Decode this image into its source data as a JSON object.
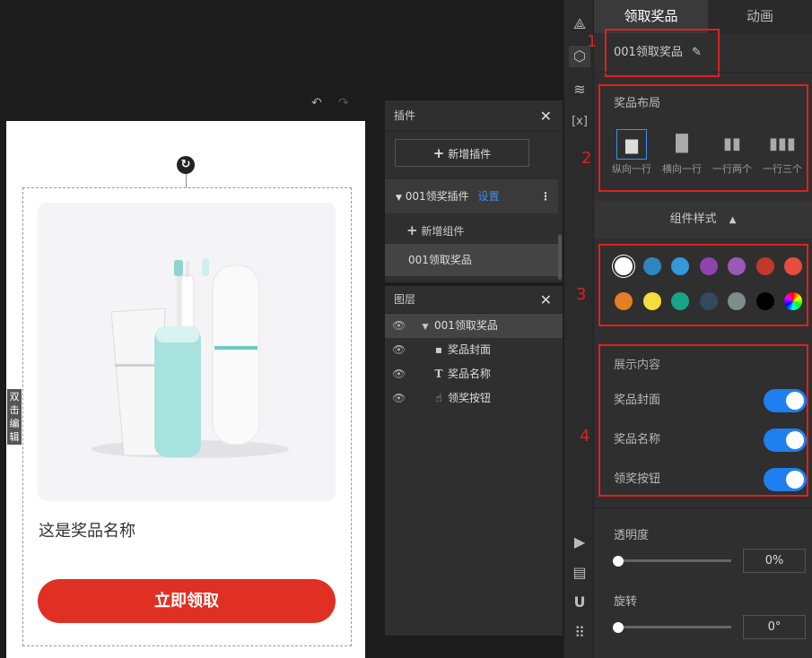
{
  "canvas": {
    "undo_icon": "undo-icon",
    "redo_icon": "redo-icon",
    "prize_name": "这是奖品名称",
    "claim_button": "立即领取",
    "double_click_edit": "双击编辑"
  },
  "plugin_panel": {
    "title": "插件",
    "add_plugin": "新增插件",
    "plugin_name": "001领奖插件",
    "settings": "设置",
    "add_component": "新增组件",
    "component_name": "001领取奖品"
  },
  "layers_panel": {
    "title": "图层",
    "items": [
      {
        "label": "001领取奖品",
        "glyph": "▼"
      },
      {
        "label": "奖品封面",
        "glyph": "▪"
      },
      {
        "label": "奖品名称",
        "glyph": "T"
      },
      {
        "label": "领奖按钮",
        "glyph": "☝"
      }
    ]
  },
  "props": {
    "tabs": {
      "prize": "领取奖品",
      "animation": "动画"
    },
    "component_name": "001领取奖品",
    "annotations": [
      "1",
      "2",
      "3",
      "4"
    ],
    "layout": {
      "title": "奖品布局",
      "options": [
        "纵向一行",
        "横向一行",
        "一行两个",
        "一行三个"
      ],
      "selected": "纵向一行"
    },
    "style_header": "组件样式",
    "colors": [
      "#ffffff",
      "#2e86c1",
      "#3498db",
      "#8e44ad",
      "#9b59b6",
      "#c0392b",
      "#e74c3c",
      "#e67e22",
      "#f7dc40",
      "#17a589",
      "#34495e",
      "#7f8c8d",
      "#000000",
      "rainbow"
    ],
    "selected_color": "#ffffff",
    "display": {
      "title": "展示内容",
      "items": [
        {
          "label": "奖品封面",
          "on": true
        },
        {
          "label": "奖品名称",
          "on": true
        },
        {
          "label": "领奖按钮",
          "on": true
        }
      ]
    },
    "opacity": {
      "label": "透明度",
      "value": "0%"
    },
    "rotation": {
      "label": "旋转",
      "value": "0°"
    }
  }
}
